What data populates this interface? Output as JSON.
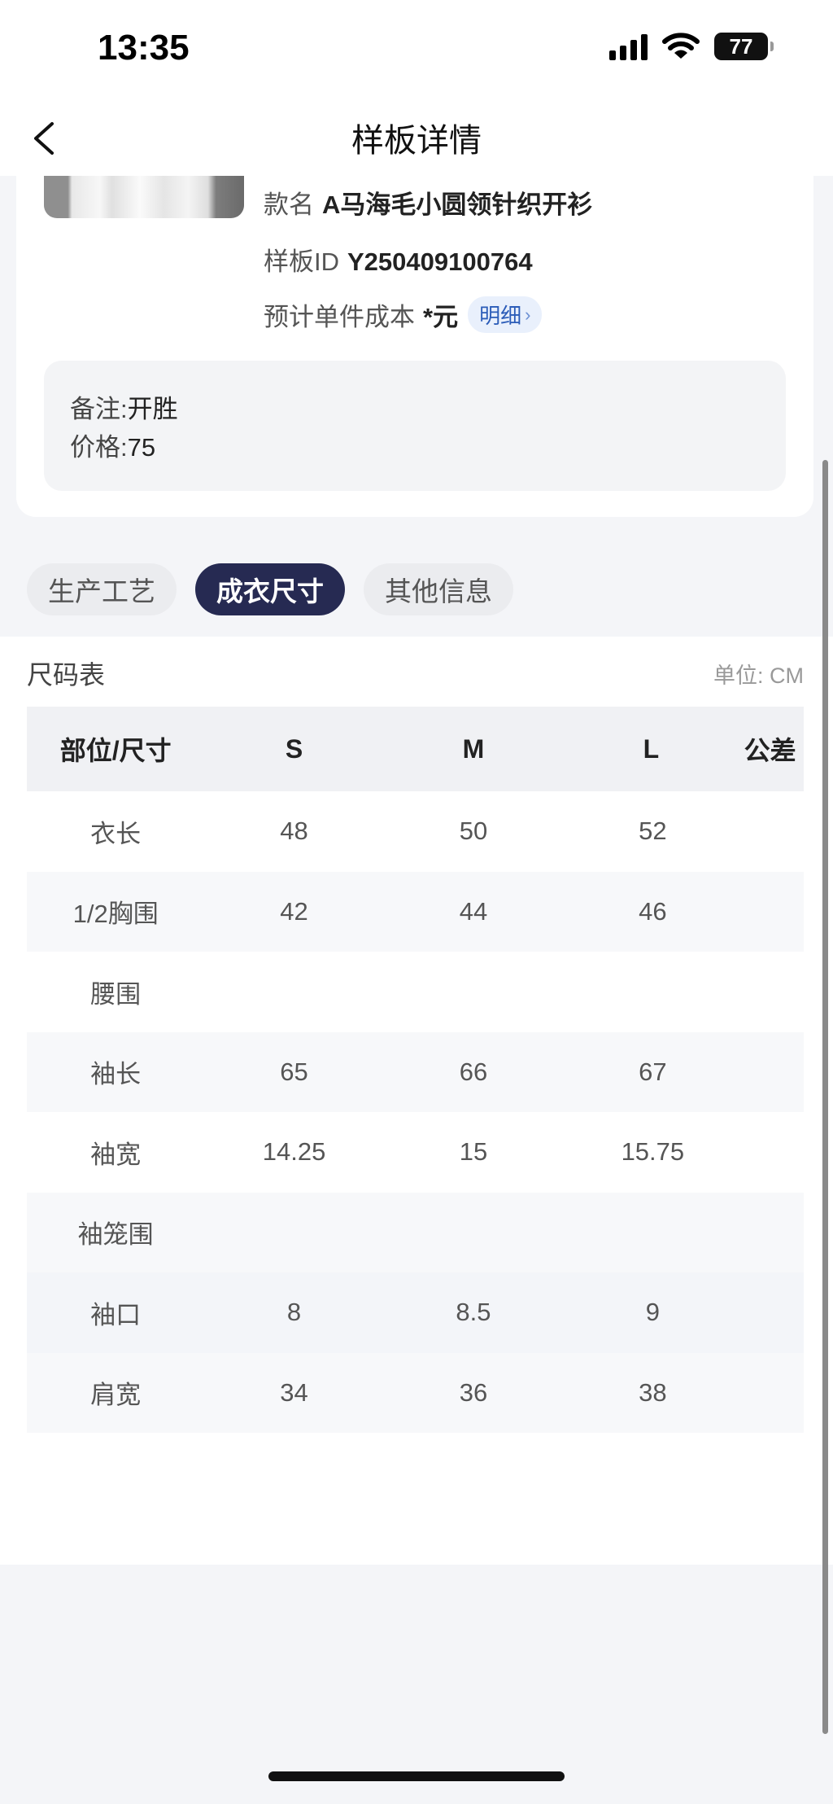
{
  "status_bar": {
    "time": "13:35",
    "battery": "77"
  },
  "nav": {
    "title": "样板详情"
  },
  "sample": {
    "name_label": "款名",
    "name_value": "A马海毛小圆领针织开衫",
    "id_label": "样板ID",
    "id_value": "Y250409100764",
    "cost_label": "预计单件成本",
    "cost_value": "*元",
    "detail_label": "明细"
  },
  "notes": {
    "remark_label": "备注:",
    "remark_value": "开胜",
    "price_label": "价格:",
    "price_value": "75"
  },
  "tabs": [
    {
      "label": "生产工艺",
      "active": false
    },
    {
      "label": "成衣尺寸",
      "active": true
    },
    {
      "label": "其他信息",
      "active": false
    }
  ],
  "size_table": {
    "title": "尺码表",
    "unit": "单位: CM",
    "headers": [
      "部位/尺寸",
      "S",
      "M",
      "L",
      "公差"
    ],
    "rows": [
      [
        "衣长",
        "48",
        "50",
        "52",
        ""
      ],
      [
        "1/2胸围",
        "42",
        "44",
        "46",
        ""
      ],
      [
        "腰围",
        "",
        "",
        "",
        ""
      ],
      [
        "袖长",
        "65",
        "66",
        "67",
        ""
      ],
      [
        "袖宽",
        "14.25",
        "15",
        "15.75",
        ""
      ],
      [
        "袖笼围",
        "",
        "",
        "",
        ""
      ],
      [
        "袖口",
        "8",
        "8.5",
        "9",
        ""
      ],
      [
        "肩宽",
        "34",
        "36",
        "38",
        ""
      ]
    ]
  },
  "colors": {
    "active_tab": "#262a52",
    "detail_tag_bg": "#e9f0fc",
    "detail_tag_text": "#2b5cb8",
    "page_bg": "#f4f5f8"
  },
  "icons": {
    "back": "chevron-left-icon",
    "wifi": "wifi-icon",
    "signal": "signal-icon",
    "battery": "battery-icon"
  }
}
